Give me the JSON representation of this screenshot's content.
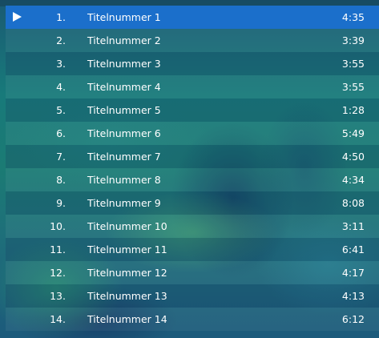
{
  "tracks": [
    {
      "number": "1.",
      "title": "Titelnummer 1",
      "duration": "4:35",
      "playing": true
    },
    {
      "number": "2.",
      "title": "Titelnummer 2",
      "duration": "3:39"
    },
    {
      "number": "3.",
      "title": "Titelnummer 3",
      "duration": "3:55"
    },
    {
      "number": "4.",
      "title": "Titelnummer 4",
      "duration": "3:55"
    },
    {
      "number": "5.",
      "title": "Titelnummer 5",
      "duration": "1:28"
    },
    {
      "number": "6.",
      "title": "Titelnummer 6",
      "duration": "5:49"
    },
    {
      "number": "7.",
      "title": "Titelnummer 7",
      "duration": "4:50"
    },
    {
      "number": "8.",
      "title": "Titelnummer 8",
      "duration": "4:34"
    },
    {
      "number": "9.",
      "title": "Titelnummer 9",
      "duration": "8:08"
    },
    {
      "number": "10.",
      "title": "Titelnummer 10",
      "duration": "3:11"
    },
    {
      "number": "11.",
      "title": "Titelnummer 11",
      "duration": "6:41"
    },
    {
      "number": "12.",
      "title": "Titelnummer 12",
      "duration": "4:17"
    },
    {
      "number": "13.",
      "title": "Titelnummer 13",
      "duration": "4:13"
    },
    {
      "number": "14.",
      "title": "Titelnummer 14",
      "duration": "6:12"
    }
  ],
  "colors": {
    "selected_row": "#1b6fcb",
    "text": "#ffffff"
  },
  "icons": {
    "now_playing": "play-icon"
  }
}
